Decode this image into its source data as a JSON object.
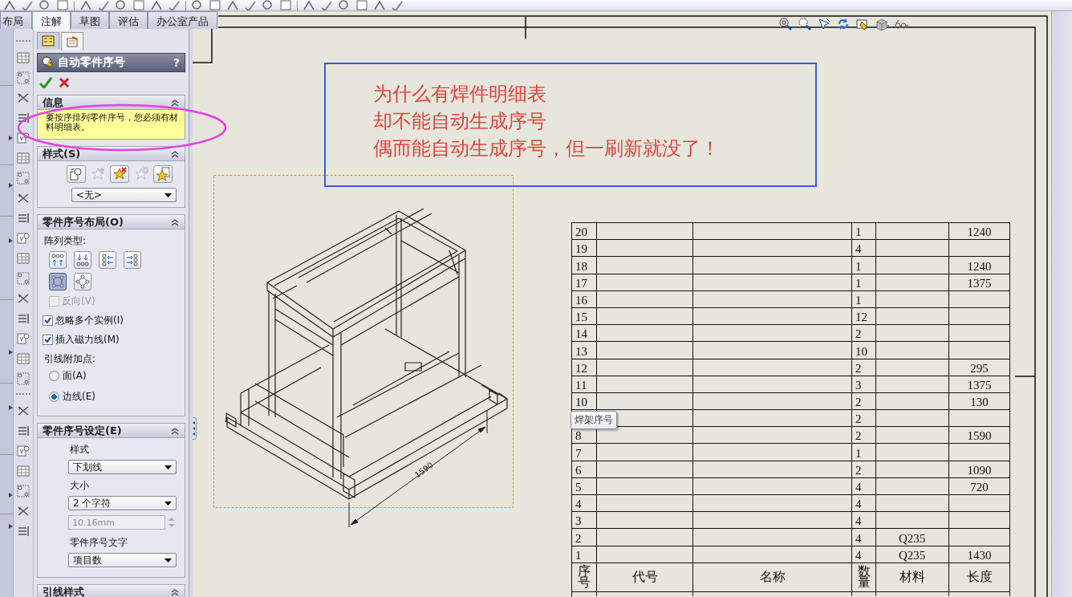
{
  "tabs": [
    {
      "label": "布局",
      "selected": false
    },
    {
      "label": "注解",
      "selected": true
    },
    {
      "label": "草图",
      "selected": false
    },
    {
      "label": "评估",
      "selected": false
    },
    {
      "label": "办公室产品",
      "selected": false
    }
  ],
  "property_manager": {
    "tabs": [
      {
        "selected": false
      },
      {
        "selected": true
      }
    ],
    "title": "自动零件序号",
    "help": "?",
    "message": {
      "title": "信息",
      "expanded": true,
      "text": "要按序排列零件序号，您必须有材料明细表。"
    },
    "style": {
      "title": "样式(S)",
      "expanded": true,
      "buttons": [
        {
          "disabled": false
        },
        {
          "disabled": true
        },
        {
          "disabled": false
        },
        {
          "disabled": true
        },
        {
          "disabled": false
        }
      ],
      "dropdown": "<无>"
    },
    "layout": {
      "title": "零件序号布局(O)",
      "expanded": true,
      "array_label": "阵列类型:",
      "array_types": [
        {
          "selected": false
        },
        {
          "selected": false
        },
        {
          "selected": false
        },
        {
          "selected": false
        },
        {
          "selected": true
        },
        {
          "selected": false
        }
      ],
      "checkboxes": [
        {
          "label": "反向(V)",
          "checked": false,
          "disabled": true
        },
        {
          "label": "忽略多个实例(I)",
          "checked": true,
          "disabled": false
        },
        {
          "label": "插入磁力线(M)",
          "checked": true,
          "disabled": false
        }
      ],
      "attach_label": "引线附加点:",
      "radios": [
        {
          "label": "面(A)",
          "selected": false
        },
        {
          "label": "边线(E)",
          "selected": true
        }
      ]
    },
    "settings": {
      "title": "零件序号设定(E)",
      "expanded": true,
      "fields": [
        {
          "kind": "dropdown",
          "label": "样式",
          "value": "下划线"
        },
        {
          "kind": "dropdown",
          "label": "大小",
          "value": "2 个字符"
        },
        {
          "kind": "spin",
          "value": "10.16mm",
          "disabled": true
        },
        {
          "kind": "dropdown",
          "label": "零件序号文字",
          "value": "项目数"
        }
      ]
    },
    "leader": {
      "title": "引线样式",
      "expanded": true
    }
  },
  "note": {
    "lines": [
      "为什么有焊件明细表",
      "却不能自动生成序号",
      "偶而能自动生成序号，但一刷新就没了！"
    ]
  },
  "drawing_view": {
    "dimension": "1590"
  },
  "bom_table": {
    "columns": [
      "序号",
      "代号",
      "名称",
      "数量",
      "材料",
      "长度"
    ],
    "rows": [
      {
        "item": "20",
        "qty": "1",
        "length": "1240"
      },
      {
        "item": "19",
        "qty": "4"
      },
      {
        "item": "18",
        "qty": "1",
        "length": "1240"
      },
      {
        "item": "17",
        "qty": "1",
        "length": "1375"
      },
      {
        "item": "16",
        "qty": "1"
      },
      {
        "item": "15",
        "qty": "12"
      },
      {
        "item": "14",
        "qty": "2"
      },
      {
        "item": "13",
        "qty": "10"
      },
      {
        "item": "12",
        "qty": "2",
        "length": "295"
      },
      {
        "item": "11",
        "qty": "3",
        "length": "1375"
      },
      {
        "item": "10",
        "qty": "2",
        "length": "130"
      },
      {
        "qty": "2"
      },
      {
        "item": "8",
        "qty": "2",
        "length": "1590"
      },
      {
        "item": "7",
        "qty": "1"
      },
      {
        "item": "6",
        "qty": "2",
        "length": "1090"
      },
      {
        "item": "5",
        "qty": "4",
        "length": "720"
      },
      {
        "item": "4",
        "qty": "4"
      },
      {
        "item": "3",
        "qty": "4"
      },
      {
        "item": "2",
        "qty": "4",
        "material": "Q235"
      },
      {
        "item": "1",
        "qty": "4",
        "material": "Q235",
        "length": "1430"
      }
    ]
  },
  "tooltip": "焊架序号"
}
